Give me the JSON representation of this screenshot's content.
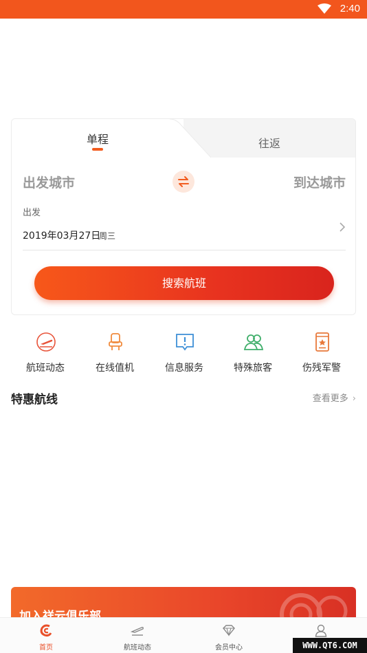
{
  "status_bar": {
    "time": "2:40",
    "wifi_icon": "wifi-icon"
  },
  "booking": {
    "tabs": [
      {
        "label": "单程"
      },
      {
        "label": "往返"
      }
    ],
    "from_city": "出发城市",
    "to_city": "到达城市",
    "date_label": "出发",
    "date_value": "2019年03月27日",
    "date_weekday": "周三",
    "search_label": "搜索航班"
  },
  "quick_actions": [
    {
      "label": "航班动态",
      "icon": "plane-icon"
    },
    {
      "label": "在线值机",
      "icon": "seat-icon"
    },
    {
      "label": "信息服务",
      "icon": "info-icon"
    },
    {
      "label": "特殊旅客",
      "icon": "passengers-icon"
    },
    {
      "label": "伤残军警",
      "icon": "certificate-icon"
    }
  ],
  "deals": {
    "title": "特惠航线",
    "more": "查看更多"
  },
  "club_banner": {
    "text": "加入祥云俱乐部"
  },
  "tab_bar": [
    {
      "label": "首页",
      "icon": "home-logo-icon",
      "active": true
    },
    {
      "label": "航班动态",
      "icon": "flight-icon",
      "active": false
    },
    {
      "label": "会员中心",
      "icon": "diamond-icon",
      "active": false
    },
    {
      "label": "",
      "icon": "user-icon",
      "active": false
    }
  ],
  "watermark": "WWW.QT6.COM",
  "colors": {
    "accent": "#f2561d",
    "button_start": "#f7581a",
    "button_end": "#d9241d",
    "muted_text": "#999999"
  }
}
